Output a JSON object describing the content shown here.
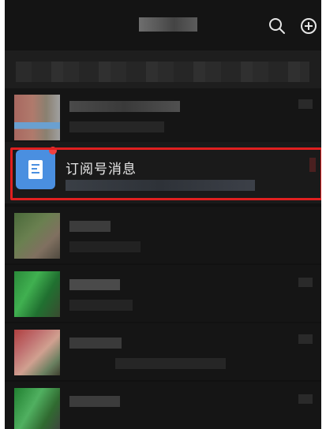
{
  "header": {
    "search_icon": "search-icon",
    "add_icon": "plus-circle-icon"
  },
  "subscription": {
    "title": "订阅号消息",
    "icon": "document-icon",
    "has_unread_dot": true
  },
  "colors": {
    "background": "#111111",
    "avatar_blue": "#4a8fe0",
    "unread_dot": "#f04040",
    "highlight_border": "#e02020"
  }
}
